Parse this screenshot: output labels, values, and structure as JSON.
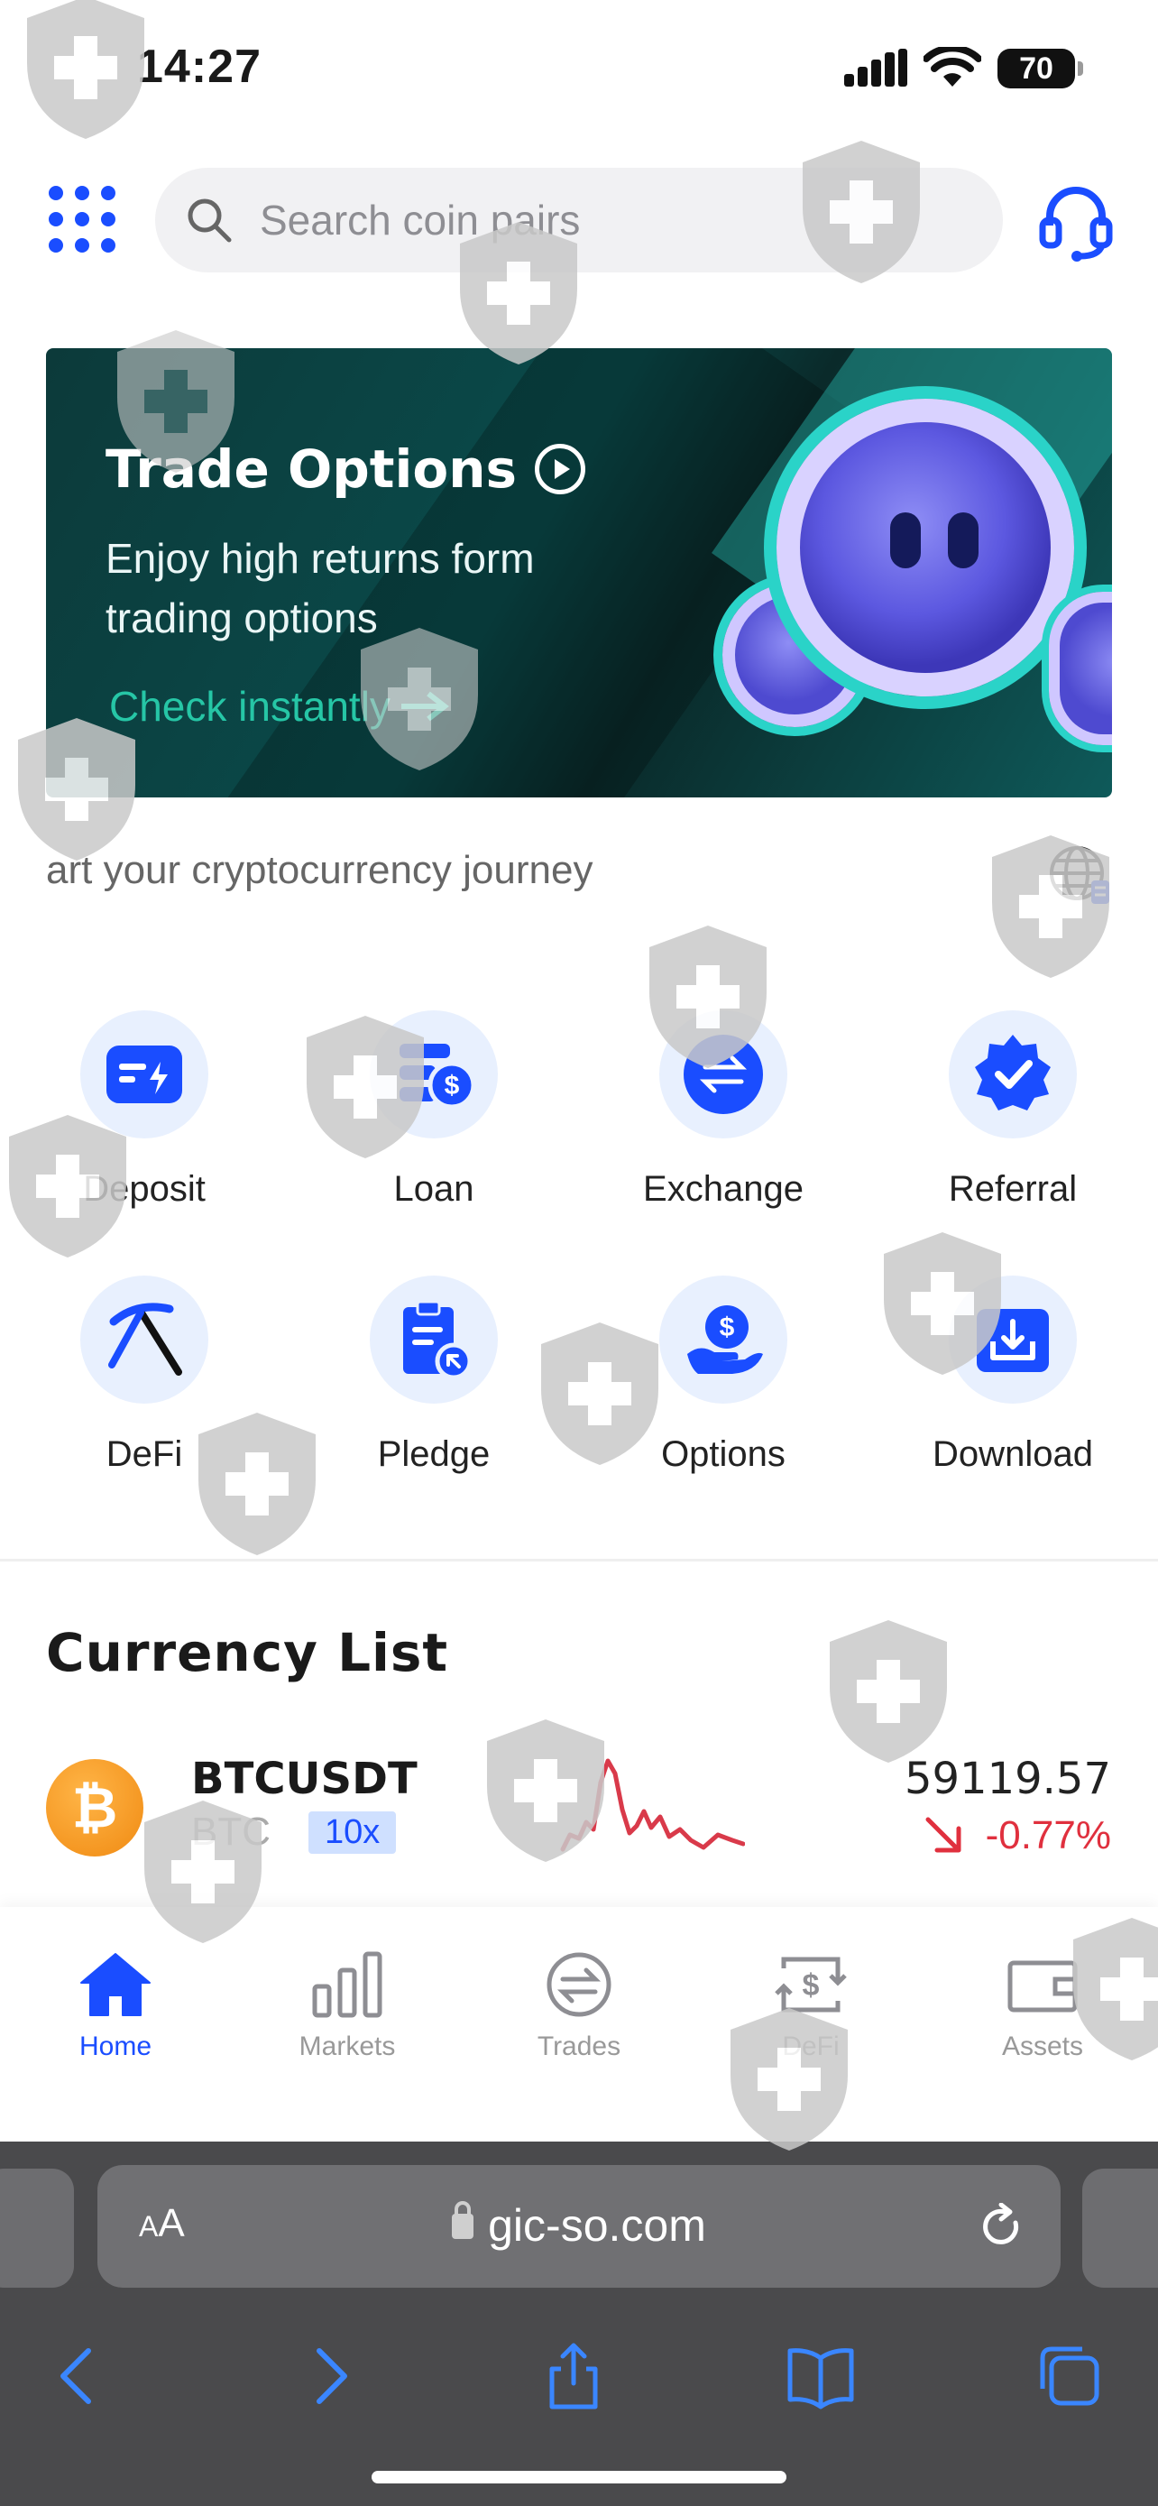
{
  "status_bar": {
    "time": "14:27",
    "battery": "70"
  },
  "header": {
    "search_placeholder": "Search coin pairs"
  },
  "banner": {
    "title": "Trade Options",
    "subtitle": "Enjoy high returns form trading options",
    "link": "Check instantly"
  },
  "marquee": {
    "text": "art your cryptocurrency journey"
  },
  "actions": [
    {
      "label": "Deposit",
      "icon": "deposit-icon"
    },
    {
      "label": "Loan",
      "icon": "loan-icon"
    },
    {
      "label": "Exchange",
      "icon": "exchange-icon"
    },
    {
      "label": "Referral",
      "icon": "referral-icon"
    },
    {
      "label": "DeFi",
      "icon": "pickaxe-icon"
    },
    {
      "label": "Pledge",
      "icon": "pledge-icon"
    },
    {
      "label": "Options",
      "icon": "options-icon"
    },
    {
      "label": "Download",
      "icon": "download-icon"
    }
  ],
  "currency_list": {
    "title": "Currency List",
    "items": [
      {
        "pair": "BTCUSDT",
        "symbol": "BTC",
        "leverage": "10x",
        "price": "59119.57",
        "change": "-0.77%"
      }
    ]
  },
  "tabbar": {
    "tabs": [
      {
        "label": "Home",
        "active": true
      },
      {
        "label": "Markets",
        "active": false
      },
      {
        "label": "Trades",
        "active": false
      },
      {
        "label": "DeFi",
        "active": false
      },
      {
        "label": "Assets",
        "active": false
      }
    ]
  },
  "safari": {
    "text_size_label": "AA",
    "url": "gic-so.com"
  },
  "colors": {
    "accent": "#1a4dff",
    "negative": "#e0303e",
    "banner_link": "#26c6a6",
    "icon_tile": "#e8f0fe"
  }
}
